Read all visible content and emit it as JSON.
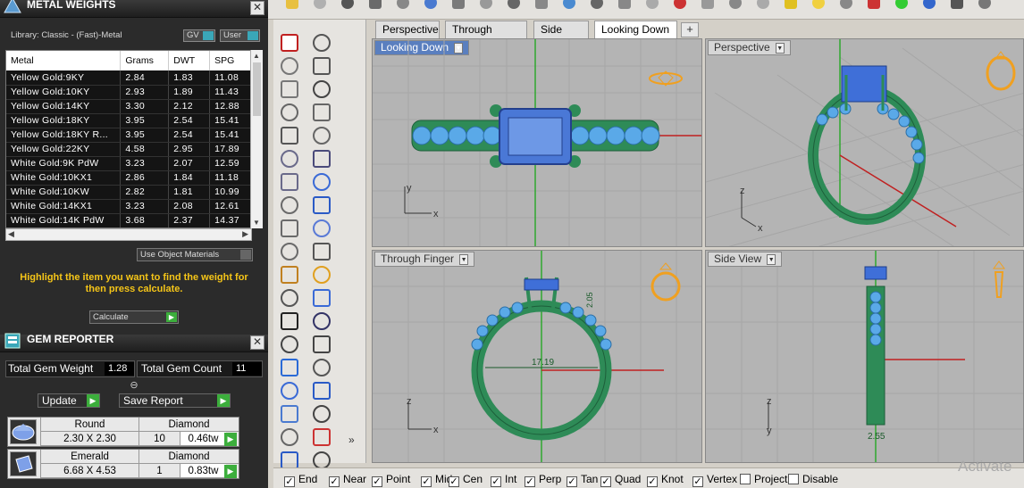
{
  "metal_panel": {
    "title": "METAL WEIGHTS",
    "library": "Library: Classic - (Fast)-Metal",
    "gv_label": "GV",
    "user_label": "User",
    "columns": [
      "Metal",
      "Grams",
      "DWT",
      "SPG"
    ],
    "rows": [
      [
        "Yellow Gold:9KY",
        "2.84",
        "1.83",
        "11.08"
      ],
      [
        "Yellow Gold:10KY",
        "2.93",
        "1.89",
        "11.43"
      ],
      [
        "Yellow Gold:14KY",
        "3.30",
        "2.12",
        "12.88"
      ],
      [
        "Yellow Gold:18KY",
        "3.95",
        "2.54",
        "15.41"
      ],
      [
        "Yellow Gold:18KY R...",
        "3.95",
        "2.54",
        "15.41"
      ],
      [
        "Yellow Gold:22KY",
        "4.58",
        "2.95",
        "17.89"
      ],
      [
        "White Gold:9K PdW",
        "3.23",
        "2.07",
        "12.59"
      ],
      [
        "White Gold:10KX1",
        "2.86",
        "1.84",
        "11.18"
      ],
      [
        "White Gold:10KW",
        "2.82",
        "1.81",
        "10.99"
      ],
      [
        "White Gold:14KX1",
        "3.23",
        "2.08",
        "12.61"
      ],
      [
        "White Gold:14K PdW",
        "3.68",
        "2.37",
        "14.37"
      ]
    ],
    "use_object_materials": "Use Object Materials",
    "highlight_text": "Highlight the item you want to find the weight for then press calculate.",
    "calculate_label": "Calculate"
  },
  "gem_panel": {
    "title": "GEM REPORTER",
    "total_weight_label": "Total Gem Weight",
    "total_weight": "1.28",
    "total_count_label": "Total Gem Count",
    "total_count": "11",
    "update_label": "Update",
    "save_report_label": "Save Report",
    "gems": [
      {
        "shape": "Round",
        "type": "Diamond",
        "size": "2.30 X 2.30",
        "count": "10",
        "weight": "0.46tw"
      },
      {
        "shape": "Emerald",
        "type": "Diamond",
        "size": "6.68 X 4.53",
        "count": "1",
        "weight": "0.83tw"
      }
    ]
  },
  "tabs": [
    "Perspective",
    "Through Finger",
    "Side View",
    "Looking Down"
  ],
  "active_tab": "Looking Down",
  "viewports": {
    "top_left": "Looking Down",
    "top_right": "Perspective",
    "bottom_left": "Through Finger",
    "bottom_right": "Side View"
  },
  "dimensions": {
    "finger_inner": "17.19",
    "prong_height": "2.05",
    "band_thickness": "2.55"
  },
  "axis_labels": {
    "x": "x",
    "y": "y",
    "z": "z"
  },
  "osnaps": [
    {
      "label": "End",
      "checked": true
    },
    {
      "label": "Near",
      "checked": true
    },
    {
      "label": "Point",
      "checked": true
    },
    {
      "label": "Mid",
      "checked": true
    },
    {
      "label": "Cen",
      "checked": true
    },
    {
      "label": "Int",
      "checked": true
    },
    {
      "label": "Perp",
      "checked": true
    },
    {
      "label": "Tan",
      "checked": true
    },
    {
      "label": "Quad",
      "checked": true
    },
    {
      "label": "Knot",
      "checked": true
    },
    {
      "label": "Vertex",
      "checked": true
    },
    {
      "label": "Project",
      "checked": false
    },
    {
      "label": "Disable",
      "checked": false
    }
  ],
  "watermark": "Activate",
  "colors": {
    "metal": "#2e8b57",
    "gem": "#5aa9e8",
    "stone": "#3f6fd8",
    "panel": "#2b2b2b",
    "hint": "#f5c518"
  }
}
